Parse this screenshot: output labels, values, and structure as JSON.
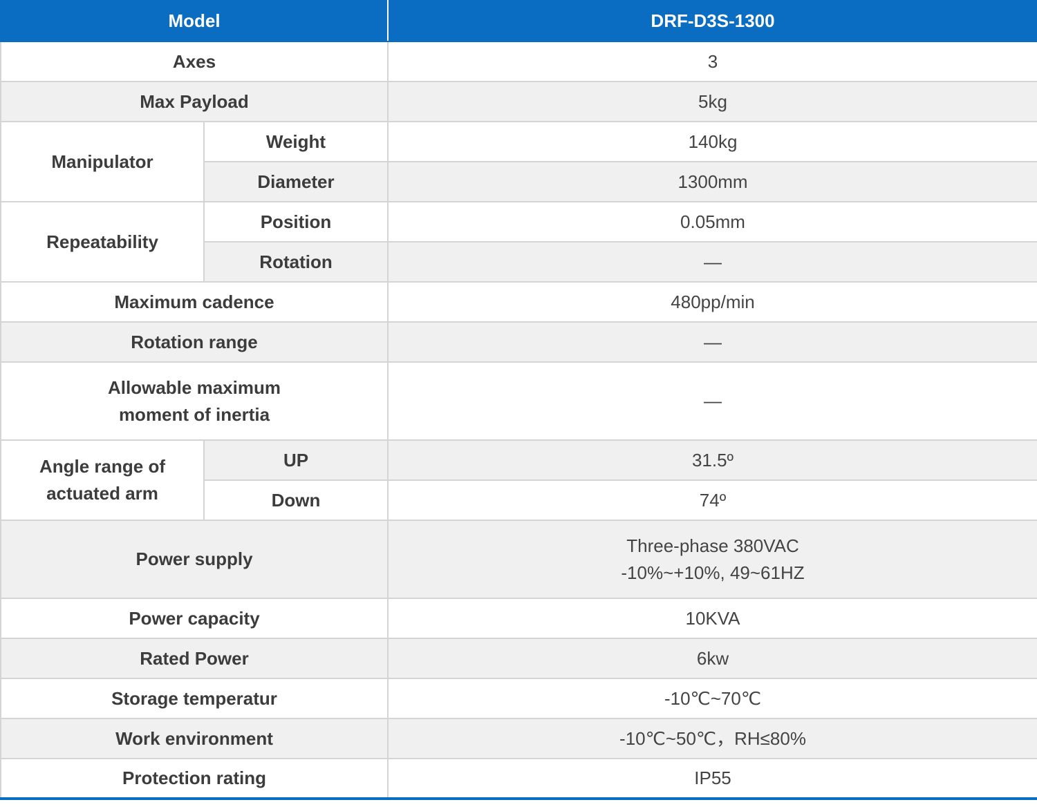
{
  "header": {
    "left": "Model",
    "right": "DRF-D3S-1300"
  },
  "rows": {
    "axes": {
      "label": "Axes",
      "value": "3"
    },
    "max_payload": {
      "label": "Max Payload",
      "value": "5kg"
    },
    "manipulator": {
      "label": "Manipulator",
      "weight": {
        "label": "Weight",
        "value": "140kg"
      },
      "diameter": {
        "label": "Diameter",
        "value": "1300mm"
      }
    },
    "repeatability": {
      "label": "Repeatability",
      "position": {
        "label": "Position",
        "value": "0.05mm"
      },
      "rotation": {
        "label": "Rotation",
        "value": "—"
      }
    },
    "max_cadence": {
      "label": "Maximum cadence",
      "value": "480pp/min"
    },
    "rotation_range": {
      "label": "Rotation range",
      "value": "—"
    },
    "inertia": {
      "label_line1": "Allowable maximum",
      "label_line2": "moment of inertia",
      "value": "—"
    },
    "angle_range": {
      "label_line1": "Angle range of",
      "label_line2": "actuated arm",
      "up": {
        "label": "UP",
        "value": "31.5º"
      },
      "down": {
        "label": "Down",
        "value": "74º"
      }
    },
    "power_supply": {
      "label": "Power supply",
      "value_line1": "Three-phase 380VAC",
      "value_line2": "-10%~+10%, 49~61HZ"
    },
    "power_capacity": {
      "label": "Power capacity",
      "value": "10KVA"
    },
    "rated_power": {
      "label": "Rated Power",
      "value": "6kw"
    },
    "storage_temp": {
      "label": "Storage temperatur",
      "value": "-10℃~70℃"
    },
    "work_env": {
      "label": "Work environment",
      "value": "-10℃~50℃，RH≤80%"
    },
    "protection": {
      "label": "Protection rating",
      "value": "IP55"
    }
  }
}
